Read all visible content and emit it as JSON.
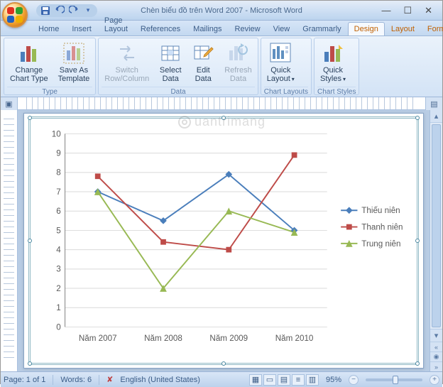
{
  "window": {
    "title": "Chèn biểu đồ trên Word 2007 - Microsoft Word"
  },
  "qat": {
    "tip": "Customize Quick Access Toolbar"
  },
  "tabs": [
    {
      "label": "Home"
    },
    {
      "label": "Insert"
    },
    {
      "label": "Page Layout"
    },
    {
      "label": "References"
    },
    {
      "label": "Mailings"
    },
    {
      "label": "Review"
    },
    {
      "label": "View"
    },
    {
      "label": "Grammarly"
    },
    {
      "label": "Design",
      "selected": true,
      "tool": true
    },
    {
      "label": "Layout",
      "tool": true
    },
    {
      "label": "Format",
      "tool": true
    }
  ],
  "ribbon": {
    "groups": [
      {
        "label": "Type",
        "buttons": [
          {
            "label": "Change\nChart Type",
            "name": "change-chart-type-button"
          },
          {
            "label": "Save As\nTemplate",
            "name": "save-as-template-button"
          }
        ]
      },
      {
        "label": "Data",
        "buttons": [
          {
            "label": "Switch\nRow/Column",
            "name": "switch-row-column-button",
            "disabled": true
          },
          {
            "label": "Select\nData",
            "name": "select-data-button"
          },
          {
            "label": "Edit\nData",
            "name": "edit-data-button"
          },
          {
            "label": "Refresh\nData",
            "name": "refresh-data-button",
            "disabled": true
          }
        ]
      },
      {
        "label": "Chart Layouts",
        "buttons": [
          {
            "label": "Quick\nLayout",
            "name": "quick-layout-button",
            "dd": true
          }
        ]
      },
      {
        "label": "Chart Styles",
        "buttons": [
          {
            "label": "Quick\nStyles",
            "name": "quick-styles-button",
            "dd": true
          }
        ]
      }
    ]
  },
  "status": {
    "page": "Page: 1 of 1",
    "words": "Words: 6",
    "lang": "English (United States)",
    "zoom": "95%"
  },
  "watermark": "uantrimang",
  "chart_data": {
    "type": "line",
    "categories": [
      "Năm 2007",
      "Năm 2008",
      "Năm 2009",
      "Năm 2010"
    ],
    "series": [
      {
        "name": "Thiếu niên",
        "color": "#4a7ebb",
        "marker": "diamond",
        "values": [
          7.0,
          5.5,
          7.9,
          5.0
        ]
      },
      {
        "name": "Thanh niên",
        "color": "#be4b48",
        "marker": "square",
        "values": [
          7.8,
          4.4,
          4.0,
          8.9
        ]
      },
      {
        "name": "Trung niên",
        "color": "#98b954",
        "marker": "triangle",
        "values": [
          7.0,
          2.0,
          6.0,
          4.9
        ]
      }
    ],
    "ylim": [
      0,
      10
    ],
    "yticks": [
      0,
      1,
      2,
      3,
      4,
      5,
      6,
      7,
      8,
      9,
      10
    ],
    "xlabel": "",
    "ylabel": "",
    "title": ""
  },
  "colors": {
    "accent": "#4a7ebb"
  }
}
